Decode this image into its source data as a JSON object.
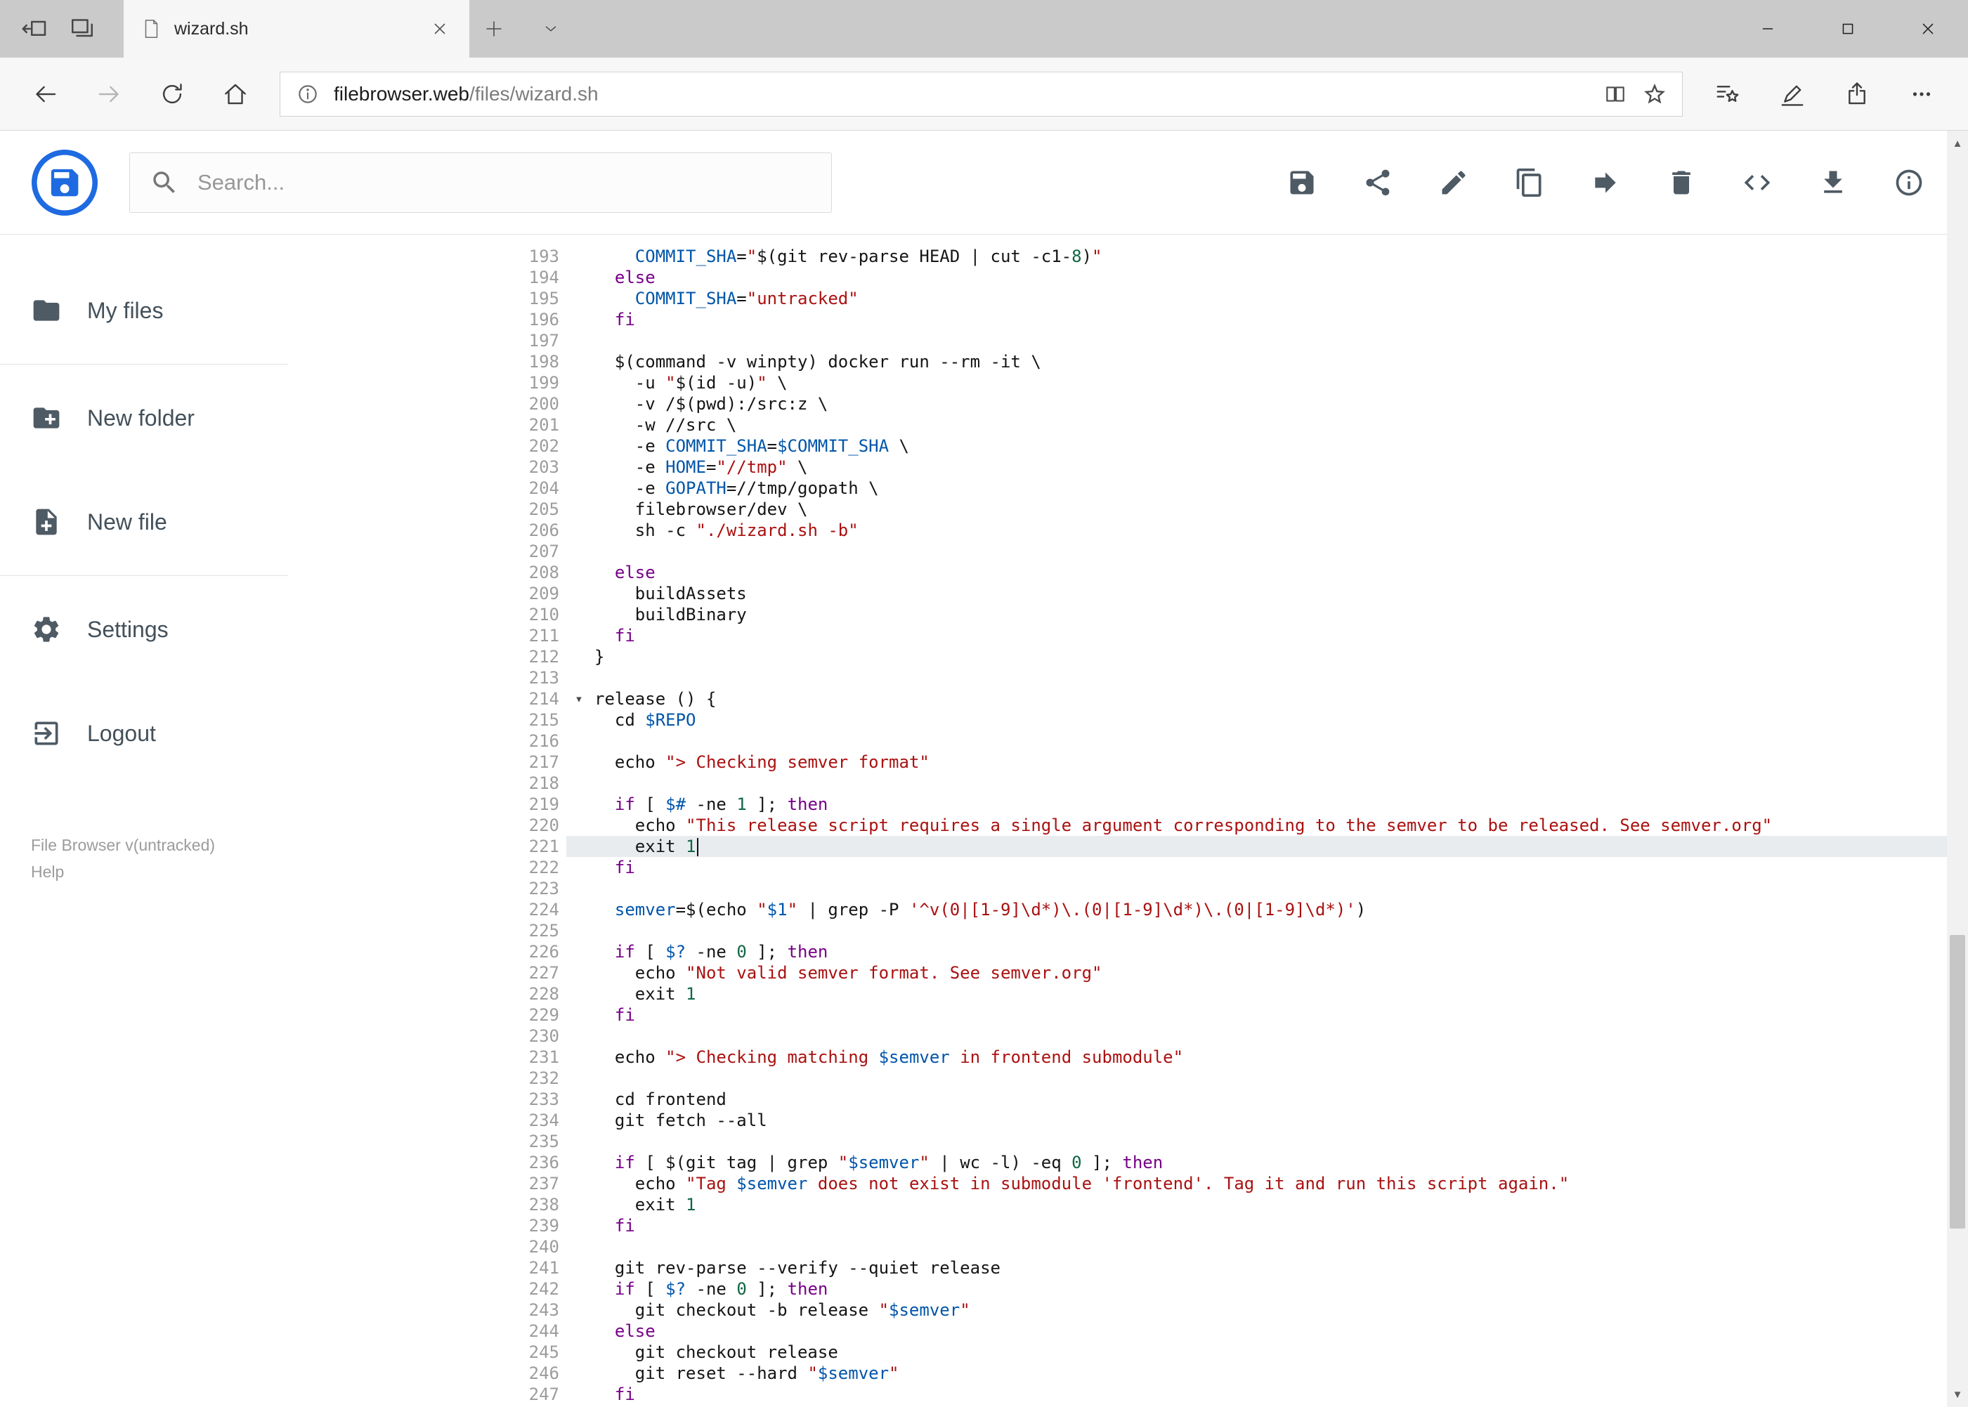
{
  "browser": {
    "tab_title": "wizard.sh",
    "url_host": "filebrowser.web",
    "url_path": "/files/wizard.sh"
  },
  "app": {
    "brand_color": "#1e6ae1",
    "search": {
      "placeholder": "Search..."
    },
    "toolbar_icons": [
      "save",
      "share",
      "rename",
      "copy",
      "move",
      "delete",
      "code-view",
      "download",
      "info"
    ],
    "sidebar": {
      "items": [
        {
          "label": "My files",
          "icon": "folder-icon"
        },
        {
          "label": "New folder",
          "icon": "new-folder-icon"
        },
        {
          "label": "New file",
          "icon": "new-file-icon"
        },
        {
          "label": "Settings",
          "icon": "settings-icon"
        },
        {
          "label": "Logout",
          "icon": "logout-icon"
        }
      ],
      "footer_version": "File Browser v(untracked)",
      "footer_help": "Help"
    }
  },
  "editor": {
    "language": "shell",
    "first_line_number": 193,
    "active_line": 221,
    "cursor_line": 221,
    "fold_marker_lines": [
      214
    ],
    "colors": {
      "keyword": "#770088",
      "string": "#aa1111",
      "variable": "#0055aa",
      "number": "#116644"
    },
    "lines": [
      "    COMMIT_SHA=\"$(git rev-parse HEAD | cut -c1-8)\"",
      "  else",
      "    COMMIT_SHA=\"untracked\"",
      "  fi",
      "",
      "  $(command -v winpty) docker run --rm -it \\",
      "    -u \"$(id -u)\" \\",
      "    -v /$(pwd):/src:z \\",
      "    -w //src \\",
      "    -e COMMIT_SHA=$COMMIT_SHA \\",
      "    -e HOME=\"//tmp\" \\",
      "    -e GOPATH=//tmp/gopath \\",
      "    filebrowser/dev \\",
      "    sh -c \"./wizard.sh -b\"",
      "",
      "  else",
      "    buildAssets",
      "    buildBinary",
      "  fi",
      "}",
      "",
      "release () {",
      "  cd $REPO",
      "",
      "  echo \"> Checking semver format\"",
      "",
      "  if [ $# -ne 1 ]; then",
      "    echo \"This release script requires a single argument corresponding to the semver to be released. See semver.org\"",
      "    exit 1",
      "  fi",
      "",
      "  semver=$(echo \"$1\" | grep -P '^v(0|[1-9]\\d*)\\.(0|[1-9]\\d*)\\.(0|[1-9]\\d*)')",
      "",
      "  if [ $? -ne 0 ]; then",
      "    echo \"Not valid semver format. See semver.org\"",
      "    exit 1",
      "  fi",
      "",
      "  echo \"> Checking matching $semver in frontend submodule\"",
      "",
      "  cd frontend",
      "  git fetch --all",
      "",
      "  if [ $(git tag | grep \"$semver\" | wc -l) -eq 0 ]; then",
      "    echo \"Tag $semver does not exist in submodule 'frontend'. Tag it and run this script again.\"",
      "    exit 1",
      "  fi",
      "",
      "  git rev-parse --verify --quiet release",
      "  if [ $? -ne 0 ]; then",
      "    git checkout -b release \"$semver\"",
      "  else",
      "    git checkout release",
      "    git reset --hard \"$semver\"",
      "  fi"
    ]
  }
}
